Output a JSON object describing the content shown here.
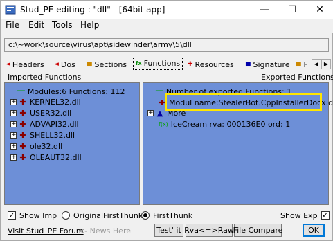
{
  "window": {
    "title": "Stud_PE editing : \"dll\" - [64bit app]"
  },
  "menu": [
    {
      "label": "File",
      "accel": "F"
    },
    {
      "label": "Edit",
      "accel": "E"
    },
    {
      "label": "Tools",
      "accel": "T"
    },
    {
      "label": "Help",
      "accel": "H"
    }
  ],
  "path": {
    "value": "c:\\~work\\source\\virus\\apt\\sidewinder\\army\\5\\dll"
  },
  "tabs": [
    {
      "label": "Headers"
    },
    {
      "label": "Dos"
    },
    {
      "label": "Sections"
    },
    {
      "label": "Functions",
      "active": true
    },
    {
      "label": "Resources"
    },
    {
      "label": "Signature"
    },
    {
      "label": "F"
    }
  ],
  "imported": {
    "title": "Imported Functions",
    "summary": "Modules:6 Functions: 112",
    "modules": [
      "KERNEL32.dll",
      "USER32.dll",
      "ADVAPI32.dll",
      "SHELL32.dll",
      "ole32.dll",
      "OLEAUT32.dll"
    ]
  },
  "exported": {
    "title": "Exported Functions",
    "count_text": "Number of exported Functions: 1",
    "module_name": "Modul name:StealerBot.CppInstallerDocx.dll",
    "more": "More",
    "function_entry": "IceCream rva: 000136E0 ord:  1"
  },
  "options": {
    "show_imp": "Show Imp",
    "original_first_thunk": "OriginalFirstThunk",
    "first_thunk": "FirstThunk",
    "show_exp": "Show Exp"
  },
  "footer": {
    "forum_link": "Visit Stud_PE Forum",
    "news_here": "<- News Here",
    "test_it": "Test' it",
    "rva_raw": "Rva<=>Raw",
    "file_compare": "File Compare",
    "ok": "OK"
  },
  "colors": {
    "panel_bg": "#6d8fd7",
    "highlight": "#ffe600"
  }
}
